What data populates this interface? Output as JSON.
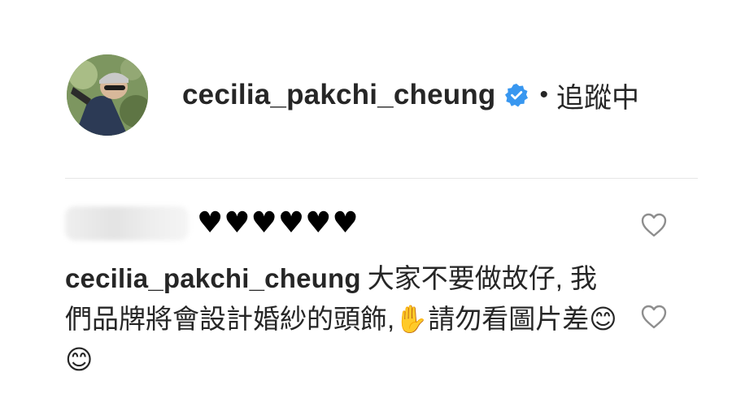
{
  "post_header": {
    "username": "cecilia_pakchi_cheung",
    "separator": "•",
    "follow_status": "追蹤中"
  },
  "comments": [
    {
      "username": "",
      "text": "♥♥♥♥♥♥"
    },
    {
      "username": "cecilia_pakchi_cheung",
      "text": "大家不要做故仔, 我們品牌將會設計婚紗的頭飾,✋請勿看圖片差😊😊"
    }
  ],
  "colors": {
    "verified_badge": "#3897f0",
    "text": "#262626",
    "divider": "#e6e6e6",
    "like_icon": "#8e8e8e"
  },
  "icons": {
    "verified": "verified-badge-icon",
    "like": "heart-outline-icon"
  }
}
